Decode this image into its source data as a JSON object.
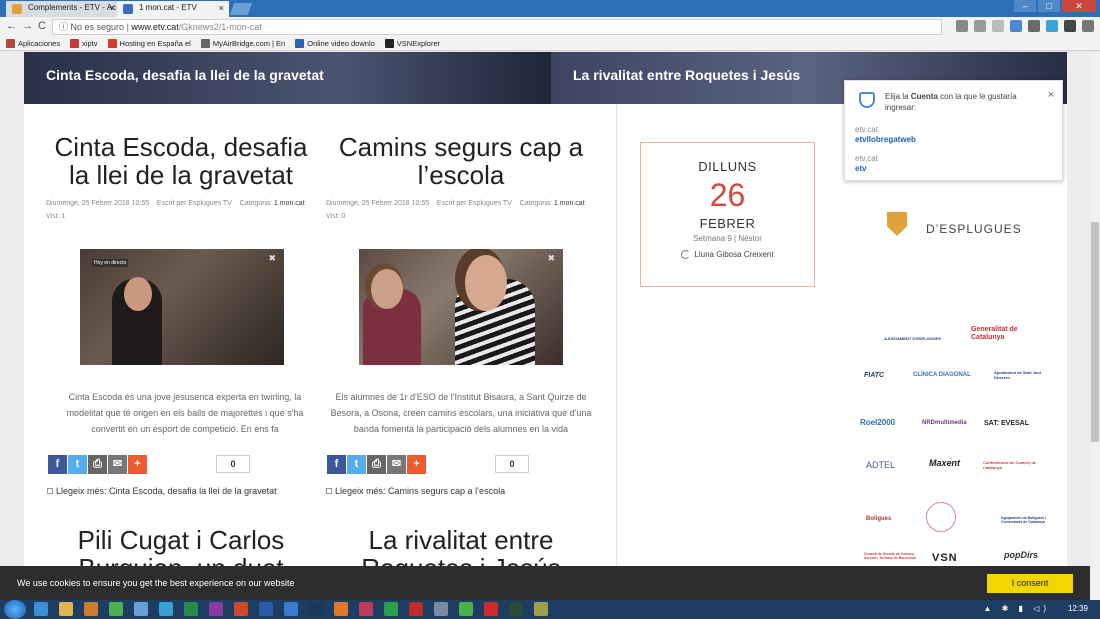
{
  "browser": {
    "tabs": [
      {
        "title": "Complements - ETV - Ac",
        "close": "×"
      },
      {
        "title": "1 mon.cat - ETV",
        "close": "×"
      }
    ],
    "nav_back": "←",
    "nav_forward": "→",
    "nav_reload": "C",
    "security_label": "No es seguro",
    "url_host": "www.etv.cat",
    "url_path": "/Gknews2/1-mon-cat",
    "bookmarks": [
      {
        "label": "Aplicaciones",
        "color": "#b14a3a"
      },
      {
        "label": "xiptv",
        "color": "#c43a3a"
      },
      {
        "label": "Hosting en España el",
        "color": "#d63a2a"
      },
      {
        "label": "MyAirBridge.com | En",
        "color": "#666666"
      },
      {
        "label": "Online video downlo",
        "color": "#2b63b0"
      },
      {
        "label": "VSNExplorer",
        "color": "#222222"
      }
    ]
  },
  "slider": {
    "left_caption": "Cinta Escoda, desafia la llei de la gravetat",
    "right_caption": "La rivalitat entre Roquetes i Jesús"
  },
  "posts": [
    {
      "title": "Cinta Escoda, desafia la llei de la gravetat",
      "date": "Diumenge, 25 Febrer 2018 10:55",
      "author_label": "Escrit per Esplugues TV",
      "category_label": "Categoria:",
      "category": "1 mon.cat",
      "visits": "Vist: 1",
      "thumb_badge": "Hoy en directo",
      "excerpt": "Cinta Escoda és una jove jesusenca experta en twirling, la modelitat que té origen en els balls de majorettes i que s'ha convertit en un esport de competició. En ens fa",
      "count": "0",
      "readmore": "Llegeix més: Cinta Escoda, desafia la llei de la gravetat"
    },
    {
      "title": "Camins segurs cap a l’escola",
      "date": "Diumenge, 25 Febrer 2018 10:55",
      "author_label": "Escrit per Esplugues TV",
      "category_label": "Categoria:",
      "category": "1 mon.cat",
      "visits": "Vist: 0",
      "excerpt": "Els alumnes de 1r d'ESO de l'Institut Bisaura, a Sant Quirze de Besora, a Osona, creen camins escolars, una iniciativa que d'una banda fomenta la participació dels alumnes en la vida",
      "count": "0",
      "readmore": "Llegeix més: Camins segurs cap a l’escola"
    },
    {
      "title": "Pili Cugat i Carlos Burguion, un duet"
    },
    {
      "title": "La rivalitat entre Roquetes i Jesús"
    }
  ],
  "share_icons": [
    {
      "name": "facebook-icon",
      "glyph": "f",
      "color": "#3b5998"
    },
    {
      "name": "twitter-icon",
      "glyph": "t",
      "color": "#55acee"
    },
    {
      "name": "print-icon",
      "glyph": "⎙",
      "color": "#666666"
    },
    {
      "name": "email-icon",
      "glyph": "✉",
      "color": "#777777"
    },
    {
      "name": "addthis-icon",
      "glyph": "+",
      "color": "#f05a30"
    }
  ],
  "datebox": {
    "weekday": "DILLUNS",
    "day": "26",
    "month": "FEBRER",
    "week": "Setmana 9 | Néstor",
    "moon": "Lluna Gibosa Creixent"
  },
  "sidebar": {
    "esplugues": "D’ESPLUGUES",
    "logos": [
      "AJUNTAMENT D'ESPLUGUES",
      "Generalitat de Catalunya",
      "FIATC",
      "CLÍNICA DIAGONAL",
      "Ajuntament de Sant Just Desvern",
      "Roel2000",
      "NRDmultimedia",
      "SAT: EVESAL",
      "ADTEL",
      "Maxent",
      "Confederació de Comerç de Catalunya",
      "Boligues",
      "Agrupament de Botiguers i Comerciants de Catalunya",
      "Consell de Gremis de Comerç, Serveis i Turisme de Barcelona",
      "VSN",
      "popDirs"
    ]
  },
  "popup": {
    "message_pre": "Elija la ",
    "message_bold": "Cuenta",
    "message_post": " con la que le gustaría ingresar:",
    "close": "×",
    "accounts": [
      {
        "domain": "etv.cat",
        "user": "etvllobregatweb"
      },
      {
        "domain": "etv.cat",
        "user": "etv"
      }
    ]
  },
  "cookie": {
    "text": "We use cookies to ensure you get the best experience on our website",
    "button": "I consent"
  },
  "taskbar": {
    "clock": "12:39"
  }
}
